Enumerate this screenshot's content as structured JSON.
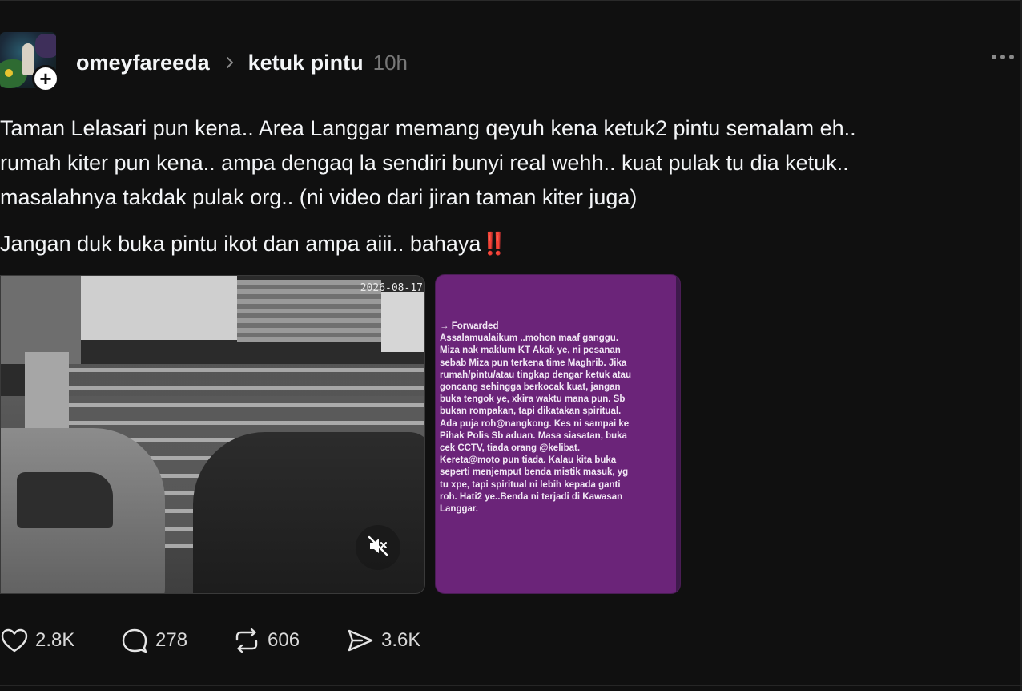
{
  "post": {
    "username": "omeyfareeda",
    "community": "ketuk pintu",
    "time_ago": "10h",
    "paragraph_1": "Taman Lelasari pun kena.. Area Langgar memang qeyuh kena ketuk2 pintu semalam eh..\nrumah kiter pun kena.. ampa dengaq la sendiri bunyi real wehh.. kuat pulak tu dia ketuk..\nmasalahnya takdak pulak org.. (ni video dari jiran taman kiter juga)",
    "paragraph_2": "Jangan duk buka pintu ikot dan ampa aiii.. bahaya",
    "paragraph_2_emoji": "‼️"
  },
  "media": {
    "video_timestamp": "2026-08-17",
    "muted_icon": "speaker-muted-icon",
    "forwarded_text": "→ Forwarded\nAssalamualaikum ..mohon maaf ganggu.\nMiza nak maklum KT Akak ye, ni pesanan\nsebab Miza pun terkena time Maghrib. Jika\nrumah/pintu/atau tingkap dengar ketuk atau\ngoncang sehingga berkocak kuat, jangan\nbuka tengok ye, xkira waktu mana pun. Sb\nbukan rompakan, tapi dikatakan spiritual.\nAda puja roh@nangkong. Kes ni sampai ke\nPihak Polis Sb aduan. Masa siasatan, buka\ncek CCTV, tiada orang @kelibat.\nKereta@moto pun tiada. Kalau kita buka\nseperti menjemput benda mistik masuk, yg\ntu xpe, tapi spiritual ni lebih kepada ganti\nroh. Hati2 ye..Benda ni terjadi di Kawasan\nLanggar.",
    "card_color": "#6b2479"
  },
  "actions": {
    "likes": "2.8K",
    "replies": "278",
    "reposts": "606",
    "shares": "3.6K"
  },
  "icons": [
    "plus-icon",
    "chevron-right-icon",
    "more-icon",
    "speaker-muted-icon",
    "heart-icon",
    "comment-icon",
    "repost-icon",
    "share-icon"
  ]
}
